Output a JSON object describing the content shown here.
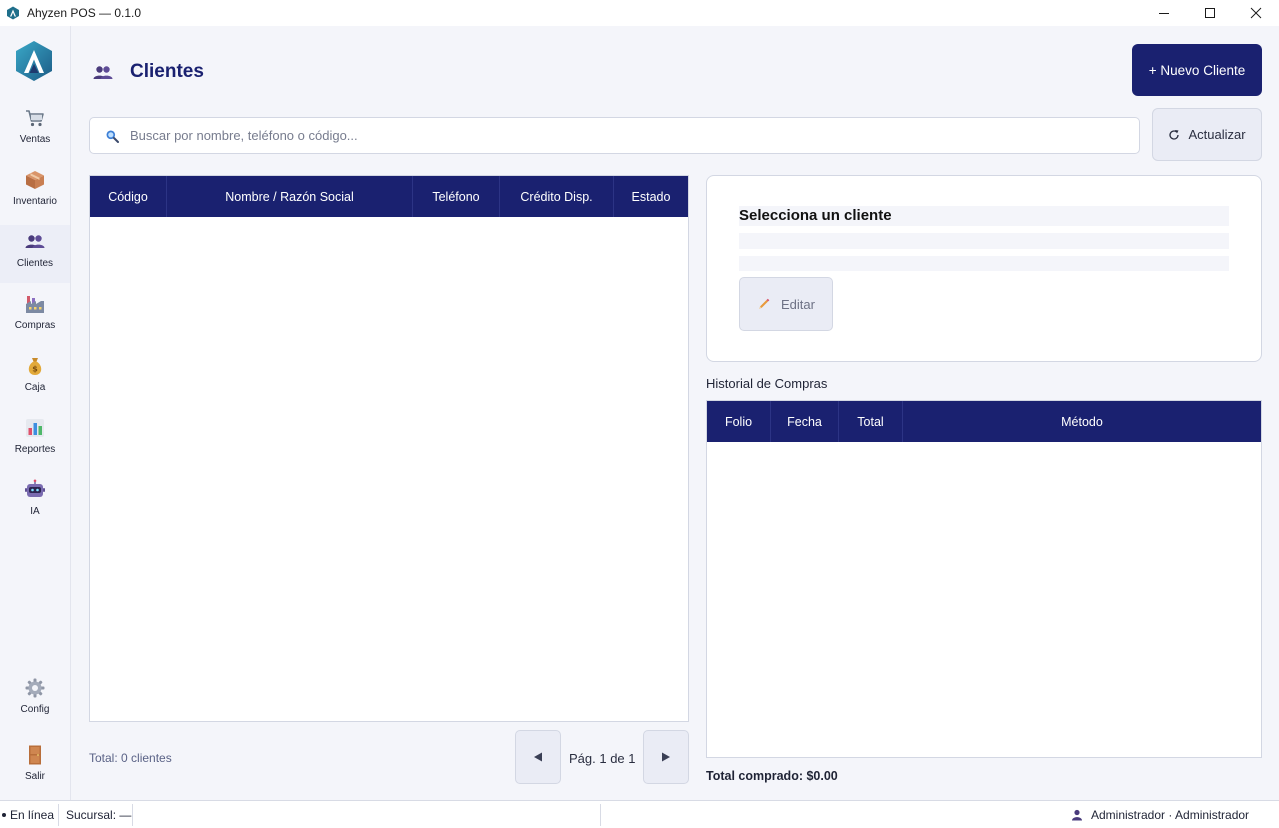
{
  "window": {
    "title": "Ahyzen POS — 0.1.0"
  },
  "sidebar": {
    "items": [
      {
        "label": "Ventas",
        "icon": "shopping-cart-icon"
      },
      {
        "label": "Inventario",
        "icon": "package-icon"
      },
      {
        "label": "Clientes",
        "icon": "users-icon"
      },
      {
        "label": "Compras",
        "icon": "factory-icon"
      },
      {
        "label": "Caja",
        "icon": "money-bag-icon"
      },
      {
        "label": "Reportes",
        "icon": "bar-chart-icon"
      },
      {
        "label": "IA",
        "icon": "robot-icon"
      }
    ],
    "bottom": [
      {
        "label": "Config",
        "icon": "gear-icon"
      },
      {
        "label": "Salir",
        "icon": "door-icon"
      }
    ],
    "active": "Clientes"
  },
  "header": {
    "title": "Clientes",
    "new_button": "+ Nuevo Cliente"
  },
  "search": {
    "placeholder": "Buscar por nombre, teléfono o código...",
    "value": "",
    "refresh_label": "Actualizar"
  },
  "clients_table": {
    "columns": [
      "Código",
      "Nombre / Razón Social",
      "Teléfono",
      "Crédito Disp.",
      "Estado"
    ],
    "rows": []
  },
  "footer": {
    "total_label": "Total: 0 clientes",
    "page_label": "Pág. 1 de 1"
  },
  "detail": {
    "placeholder_title": "Selecciona un cliente",
    "edit_label": "Editar"
  },
  "history": {
    "title": "Historial de Compras",
    "columns": [
      "Folio",
      "Fecha",
      "Total",
      "Método"
    ],
    "rows": [],
    "total_label": "Total comprado: $0.00"
  },
  "status": {
    "online": "En línea",
    "branch": "Sucursal: —",
    "user": "Administrador · Administrador"
  },
  "colors": {
    "primary": "#1a2170",
    "background": "#f4f5fa",
    "border": "#d3d7e3"
  }
}
